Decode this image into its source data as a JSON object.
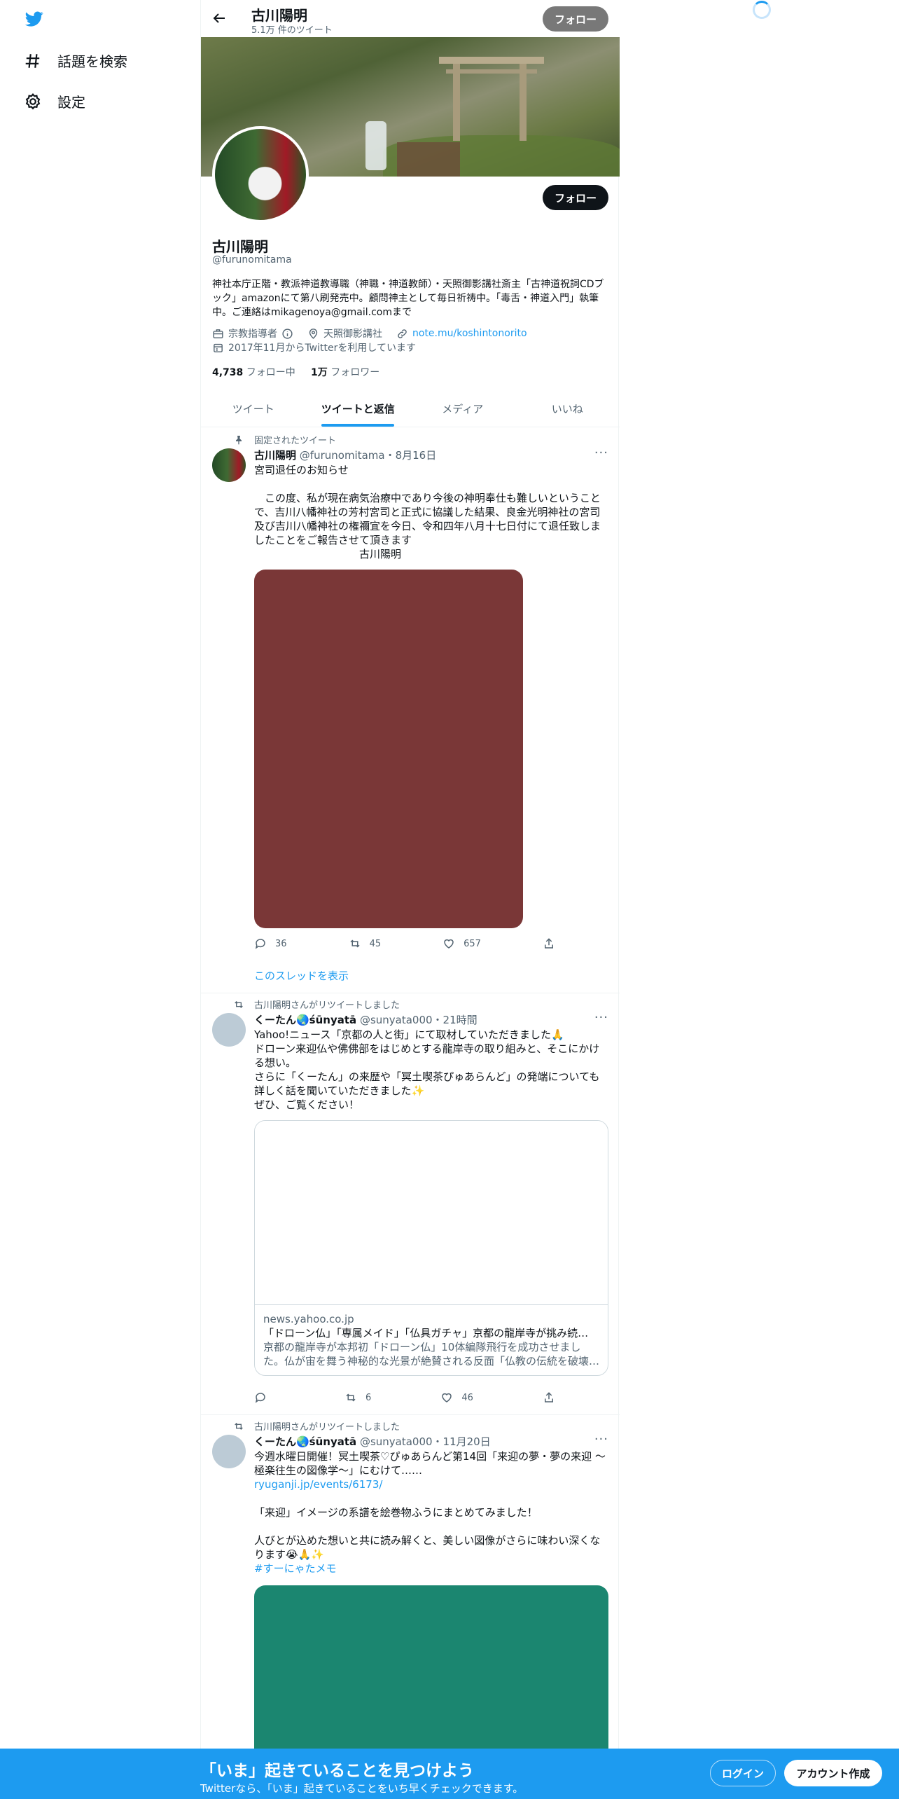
{
  "nav": {
    "explore_label": "話題を検索",
    "settings_label": "設定"
  },
  "topbar": {
    "name": "古川陽明",
    "tweet_count": "5.1万 件のツイート",
    "follow_label": "フォロー"
  },
  "profile": {
    "follow_label": "フォロー",
    "name": "古川陽明",
    "handle": "@furunomitama",
    "bio": "神社本庁正階・教派神道教導職（神職・神道教師）・天照御影講社斎主「古神道祝詞CDブック」amazonにて第八刷発売中。顧問神主として毎日祈祷中。「毒舌・神道入門」執筆中。ご連絡はmikagenoya@gmail.comまで",
    "category": "宗教指導者",
    "location": "天照御影講社",
    "link": "note.mu/koshintonorito",
    "joined": "2017年11月からTwitterを利用しています",
    "following_count": "4,738",
    "following_label": "フォロー中",
    "followers_count": "1万",
    "followers_label": "フォロワー"
  },
  "tabs": [
    {
      "label": "ツイート",
      "active": false
    },
    {
      "label": "ツイートと返信",
      "active": true
    },
    {
      "label": "メディア",
      "active": false
    },
    {
      "label": "いいね",
      "active": false
    }
  ],
  "tweets": [
    {
      "context": "固定されたツイート",
      "name": "古川陽明",
      "handle_time": "@furunomitama・8月16日",
      "text": "宮司退任のお知らせ\n\n　この度、私が現在病気治療中であり今後の神明奉仕も難しいということで、吉川八幡神社の芳村宮司と正式に協議した結果、良金光明神社の宮司及び吉川八幡神社の権禰宜を今日、令和四年八月十七日付にて退任致しましたことをご報告させて頂きます\n　　　　　　　　　　古川陽明",
      "media_color": "#7a3737",
      "replies": "36",
      "retweets": "45",
      "likes": "657",
      "show_thread": "このスレッドを表示"
    },
    {
      "context": "古川陽明さんがリツイートしました",
      "name": "くーたん🌏śūnyatā",
      "handle_time": "@sunyata000・21時間",
      "text": "Yahoo!ニュース「京都の人と街」にて取材していただきました🙏\nドローン来迎仏や佛佛部をはじめとする龍岸寺の取り組みと、そこにかける想い。\nさらに「くーたん」の来歴や「冥土喫茶ぴゅあらんど」の発端についても詳しく話を聞いていただきました✨\nぜひ、ご覧ください！",
      "card_domain": "news.yahoo.co.jp",
      "card_title": "「ドローン仏」「専属メイド」「仏具ガチャ」京都の龍岸寺が挑み続…",
      "card_desc": "京都の龍岸寺が本邦初「ドローン仏」10体編隊飛行を成功させました。仏が宙を舞う神秘的な光景が絶賛される反面「仏教の伝統を破壊…",
      "replies": "",
      "retweets": "6",
      "likes": "46"
    },
    {
      "context": "古川陽明さんがリツイートしました",
      "name": "くーたん🌏śūnyatā",
      "handle_time": "@sunyata000・11月20日",
      "text_a": "今週水曜日開催！冥土喫茶♡ぴゅあらんど第14回「来迎の夢・夢の来迎 〜極楽往生の図像学〜」にむけて……",
      "link": "ryuganji.jp/events/6173/",
      "text_b": "「来迎」イメージの系譜を絵巻物ふうにまとめてみました！\n\n人びとが込めた想いと共に読み解くと、美しい図像がさらに味わい深くなります😭🙏✨",
      "hashtag": "#すーにゃたメモ",
      "media_color": "#1b8670"
    }
  ],
  "bottom": {
    "title": "「いま」起きていることを見つけよう",
    "subtitle": "Twitterなら、「いま」起きていることをいち早くチェックできます。",
    "login_label": "ログイン",
    "signup_label": "アカウント作成"
  }
}
